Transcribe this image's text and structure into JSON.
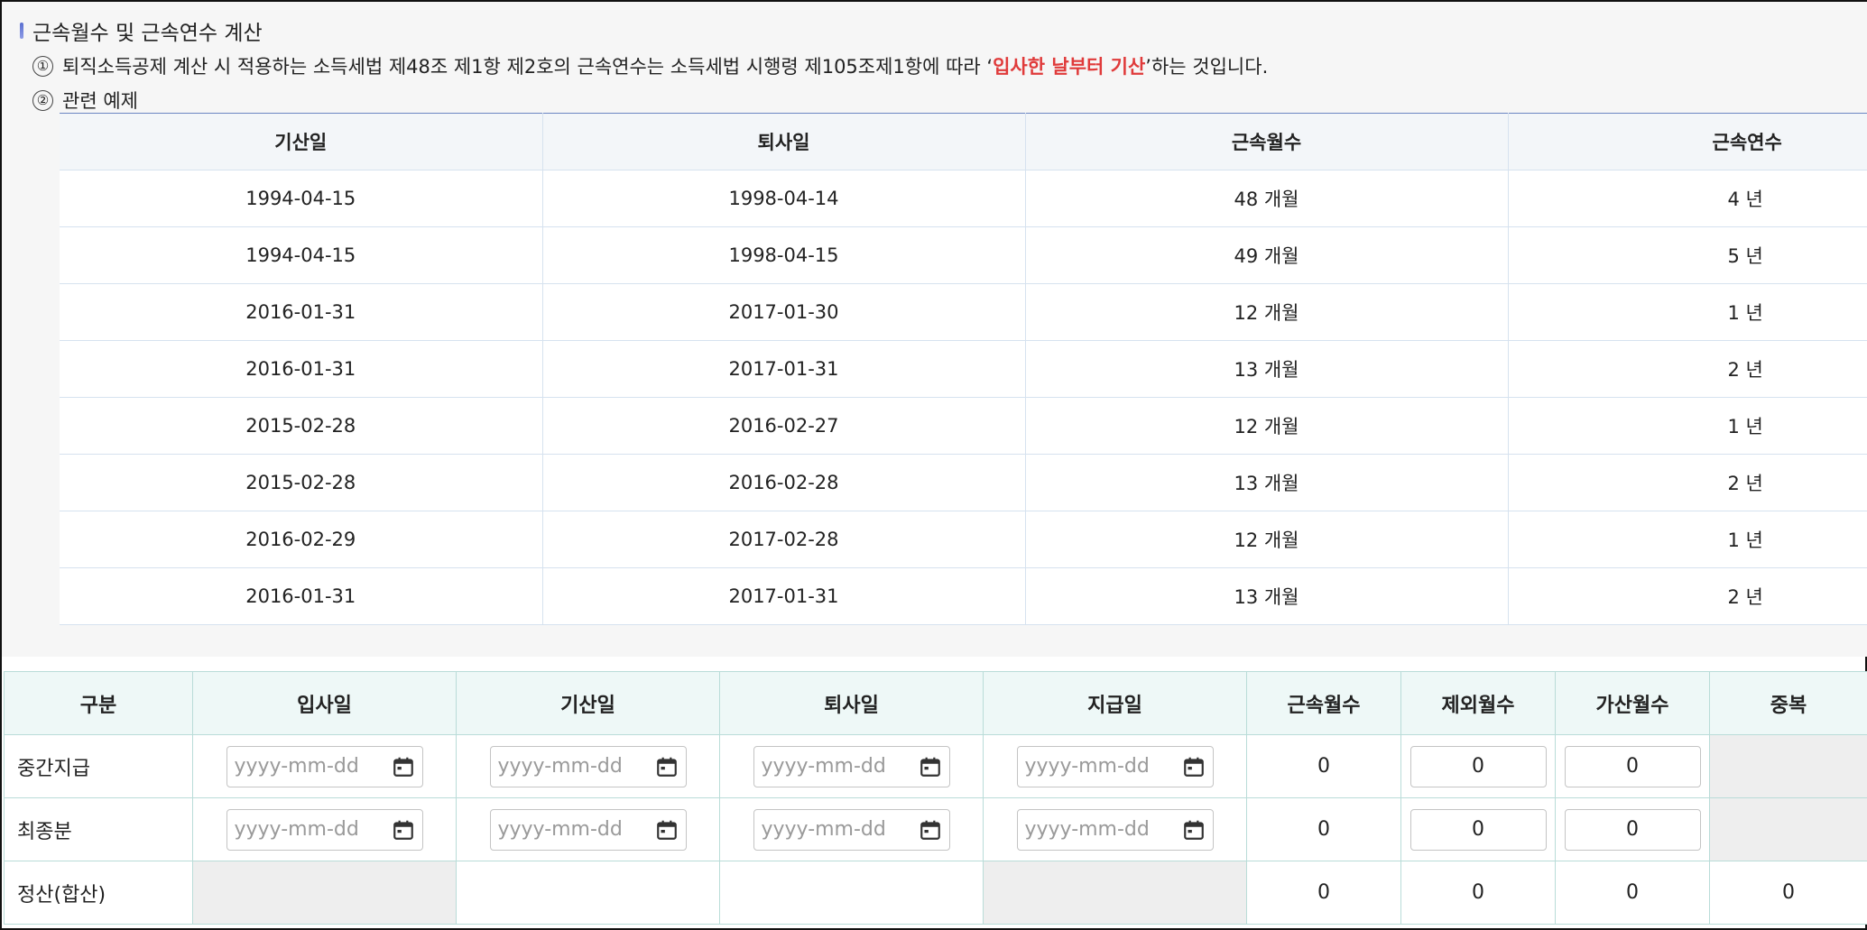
{
  "section": {
    "title": "근속월수 및 근속연수 계산",
    "note1": {
      "marker": "①",
      "pre": "퇴직소득공제 계산 시 적용하는 소득세법 제48조 제1항 제2호의 근속연수는 소득세법 시행령 제105조제1항에 따라 ‘",
      "highlight": "입사한 날부터 기산",
      "post": "’하는 것입니다."
    },
    "note2": {
      "marker": "②",
      "text": "관련 예제"
    }
  },
  "example_table": {
    "headers": [
      "기산일",
      "퇴사일",
      "근속월수",
      "근속연수"
    ],
    "rows": [
      [
        "1994-04-15",
        "1998-04-14",
        "48 개월",
        "4 년"
      ],
      [
        "1994-04-15",
        "1998-04-15",
        "49 개월",
        "5 년"
      ],
      [
        "2016-01-31",
        "2017-01-30",
        "12 개월",
        "1 년"
      ],
      [
        "2016-01-31",
        "2017-01-31",
        "13 개월",
        "2 년"
      ],
      [
        "2015-02-28",
        "2016-02-27",
        "12 개월",
        "1 년"
      ],
      [
        "2015-02-28",
        "2016-02-28",
        "13 개월",
        "2 년"
      ],
      [
        "2016-02-29",
        "2017-02-28",
        "12 개월",
        "1 년"
      ],
      [
        "2016-01-31",
        "2017-01-31",
        "13 개월",
        "2 년"
      ]
    ]
  },
  "calc_table": {
    "headers": [
      "구분",
      "입사일",
      "기산일",
      "퇴사일",
      "지급일",
      "근속월수",
      "제외월수",
      "가산월수",
      "중복"
    ],
    "date_placeholder": "yyyy-mm-dd",
    "rows": [
      {
        "label": "중간지급",
        "months": "0",
        "excluded": "0",
        "added": "0"
      },
      {
        "label": "최종분",
        "months": "0",
        "excluded": "0",
        "added": "0"
      },
      {
        "label": "정산(합산)",
        "months": "0",
        "excluded": "0",
        "added": "0",
        "duplicate": "0"
      }
    ]
  },
  "colors": {
    "highlight": "#e03a3a",
    "calc_header_bg": "#eef8f7",
    "table_border": "#b9dcd8"
  },
  "icons": {
    "date_picker": "calendar-icon"
  }
}
